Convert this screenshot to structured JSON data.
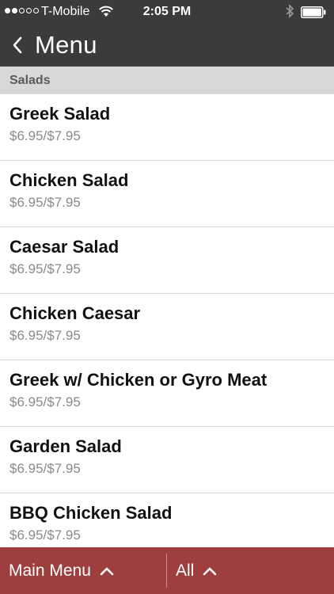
{
  "status_bar": {
    "carrier": "T-Mobile",
    "time": "2:05 PM",
    "signal_bars": 2,
    "signal_total": 5,
    "icons": [
      "wifi-icon",
      "bluetooth-icon",
      "battery-icon"
    ]
  },
  "nav": {
    "title": "Menu",
    "back_icon": "chevron-left-icon"
  },
  "section": {
    "title": "Salads"
  },
  "items": [
    {
      "name": "Greek Salad",
      "price": "$6.95/$7.95"
    },
    {
      "name": "Chicken Salad",
      "price": "$6.95/$7.95"
    },
    {
      "name": "Caesar Salad",
      "price": "$6.95/$7.95"
    },
    {
      "name": "Chicken Caesar",
      "price": "$6.95/$7.95"
    },
    {
      "name": "Greek w/ Chicken or Gyro Meat",
      "price": "$6.95/$7.95"
    },
    {
      "name": "Garden Salad",
      "price": "$6.95/$7.95"
    },
    {
      "name": "BBQ Chicken Salad",
      "price": "$6.95/$7.95"
    }
  ],
  "bottom_bar": {
    "main_menu_label": "Main Menu",
    "filter_label": "All",
    "icon": "chevron-up-icon"
  },
  "colors": {
    "nav_background": "#3b3b3b",
    "section_background": "#d8d8d8",
    "bottom_bar_background": "#9e3f3f",
    "price_text": "#8a8a8a"
  }
}
